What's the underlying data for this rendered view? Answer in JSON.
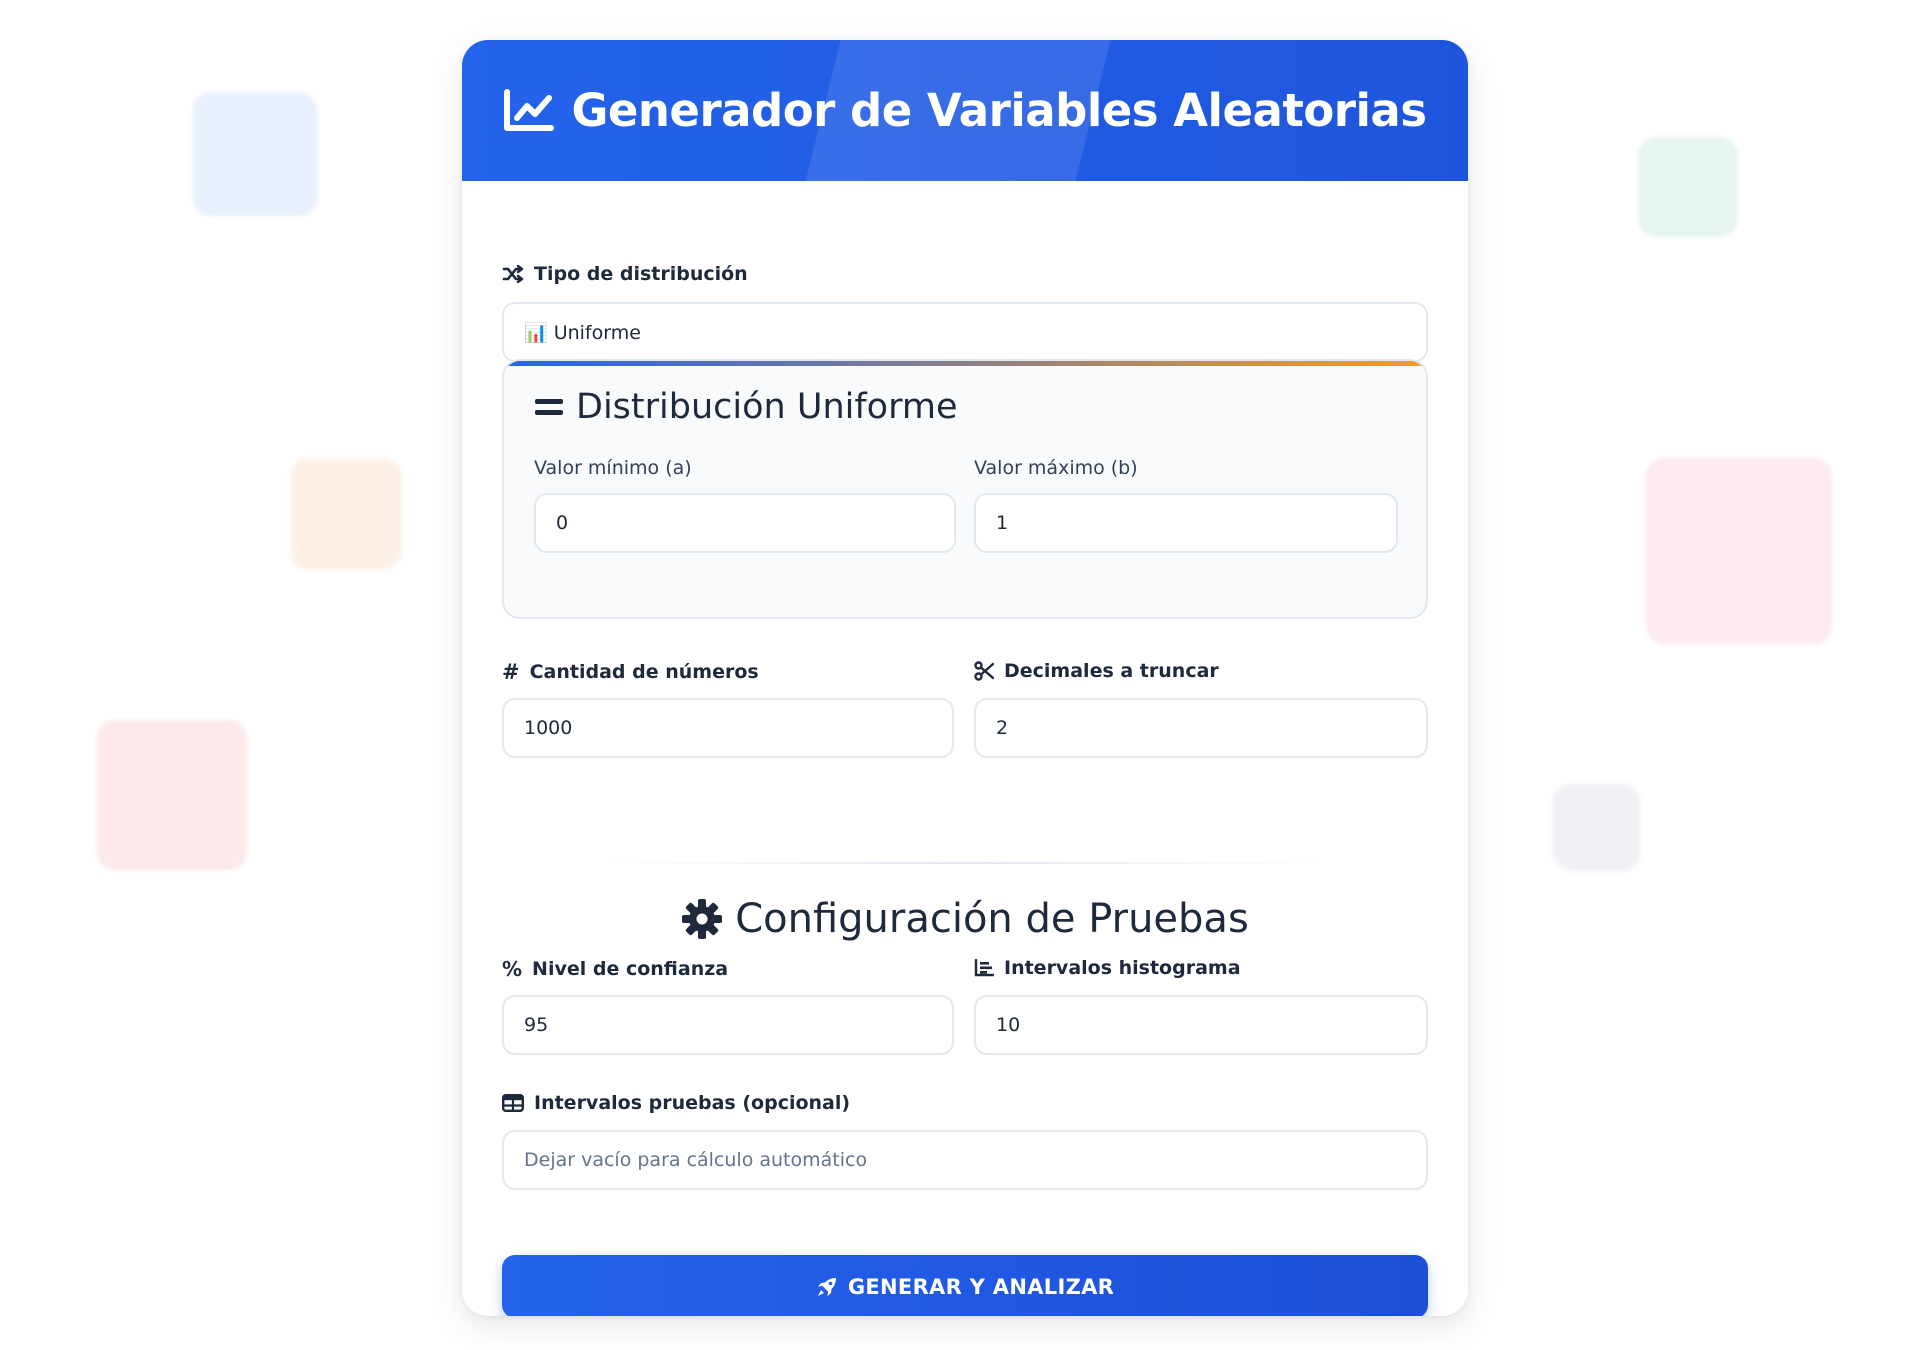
{
  "header": {
    "title": "Generador de Variables Aleatorias",
    "icon": "chart-line-icon"
  },
  "distribution_type": {
    "label": "Tipo de distribución",
    "selected": "📊 Uniforme"
  },
  "uniform": {
    "title": "Distribución Uniforme",
    "min_label": "Valor mínimo (a)",
    "min_value": "0",
    "max_label": "Valor máximo (b)",
    "max_value": "1"
  },
  "quantity": {
    "label": "Cantidad de números",
    "value": "1000"
  },
  "decimals": {
    "label": "Decimales a truncar",
    "value": "2"
  },
  "tests": {
    "title": "Configuración de Pruebas",
    "confidence_label": "Nivel de confianza",
    "confidence_value": "95",
    "histogram_label": "Intervalos histograma",
    "histogram_value": "10",
    "test_intervals_label": "Intervalos pruebas (opcional)",
    "test_intervals_placeholder": "Dejar vacío para cálculo automático"
  },
  "generate_button": {
    "label": "GENERAR Y ANALIZAR"
  },
  "colors": {
    "primary": "#2463eb",
    "accent": "#f39c23",
    "text": "#1e293b",
    "border": "#e2e8f0"
  }
}
